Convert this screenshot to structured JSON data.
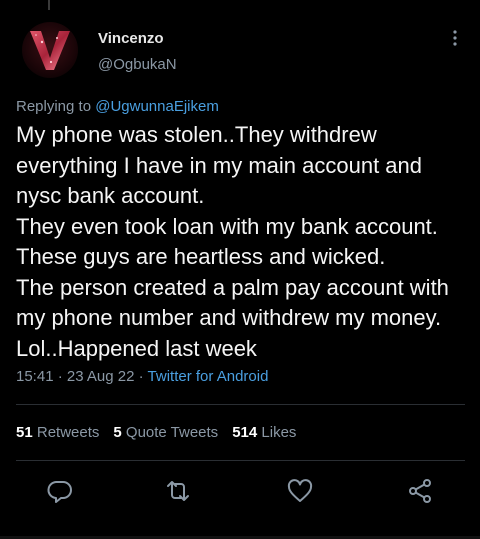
{
  "tweet": {
    "author_name": "Vincenzo",
    "author_handle": "@OgbukaN",
    "avatar_letter": "V",
    "replying_prefix": "Replying to ",
    "replying_to": "@UgwunnaEjikem",
    "text": "My phone was stolen..They withdrew everything I have in my main account and nysc bank account.\nThey even took loan with my bank account.\nThese guys are heartless and wicked.\nThe person created a palm pay account with my phone number and withdrew my money. Lol..Happened last week",
    "time": "15:41",
    "date": "23 Aug 22",
    "separator": " · ",
    "source": "Twitter for Android"
  },
  "stats": {
    "retweets_count": "51",
    "retweets_label": "Retweets",
    "quote_count": "5",
    "quote_label": "Quote Tweets",
    "likes_count": "514",
    "likes_label": "Likes"
  },
  "icons": {
    "reply": "reply-icon",
    "retweet": "retweet-icon",
    "like": "heart-icon",
    "share": "share-icon",
    "more": "more-vertical-icon"
  },
  "colors": {
    "background": "#000000",
    "text": "#f5f5f5",
    "secondary": "#8b98a5",
    "link": "#4a9fe0"
  }
}
